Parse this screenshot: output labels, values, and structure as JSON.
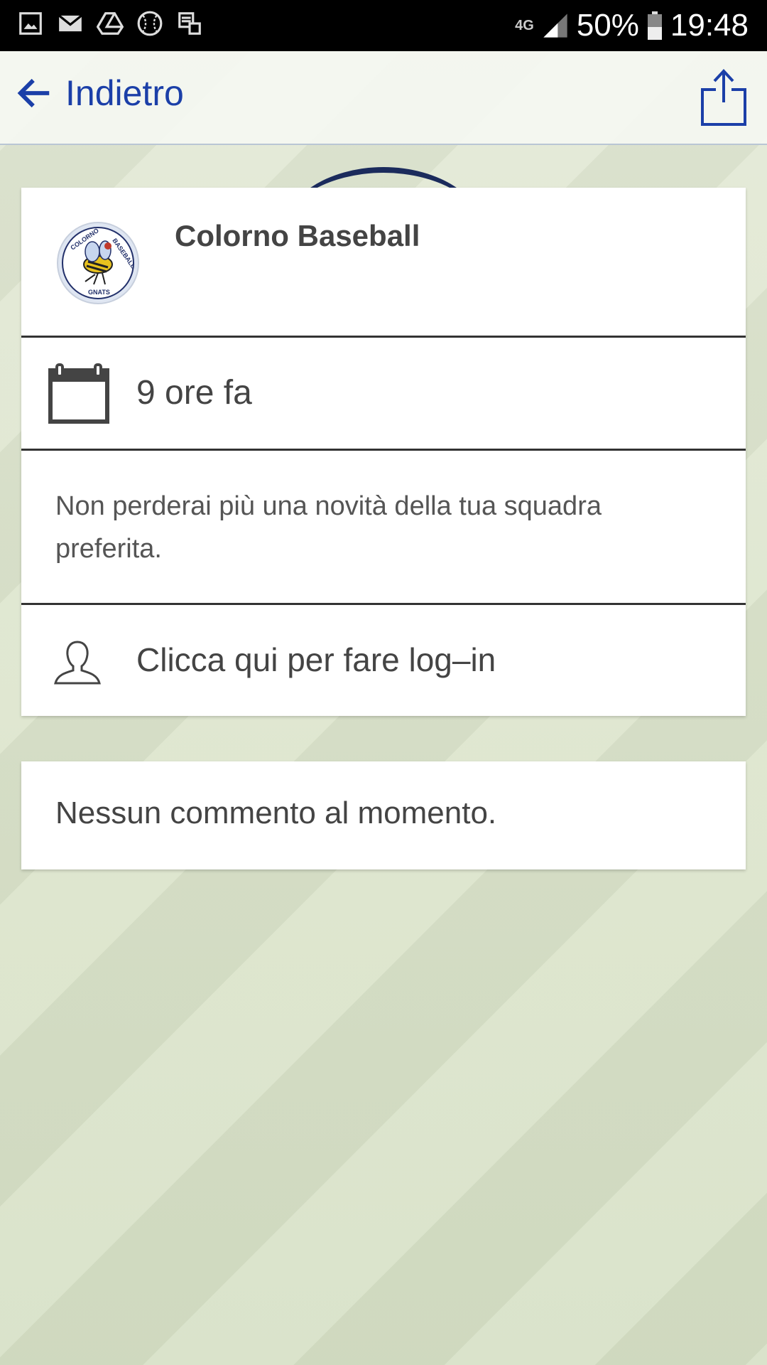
{
  "status_bar": {
    "icons_left": [
      "gallery-icon",
      "mail-icon",
      "drive-icon",
      "baseball-icon",
      "sync-icon"
    ],
    "network": "4G",
    "battery_percent": "50%",
    "time": "19:48"
  },
  "top_bar": {
    "back_label": "Indietro",
    "accent_color": "#1b3fa8"
  },
  "post": {
    "team_name": "Colorno Baseball",
    "logo_text": [
      "COLORNO",
      "BASEBALL",
      "GNATS"
    ],
    "time_ago": "9 ore fa",
    "message": "Non perderai più una novità della tua squadra preferita.",
    "login_prompt": "Clicca qui per fare log–in"
  },
  "comments": {
    "empty_text": "Nessun commento al momento."
  }
}
